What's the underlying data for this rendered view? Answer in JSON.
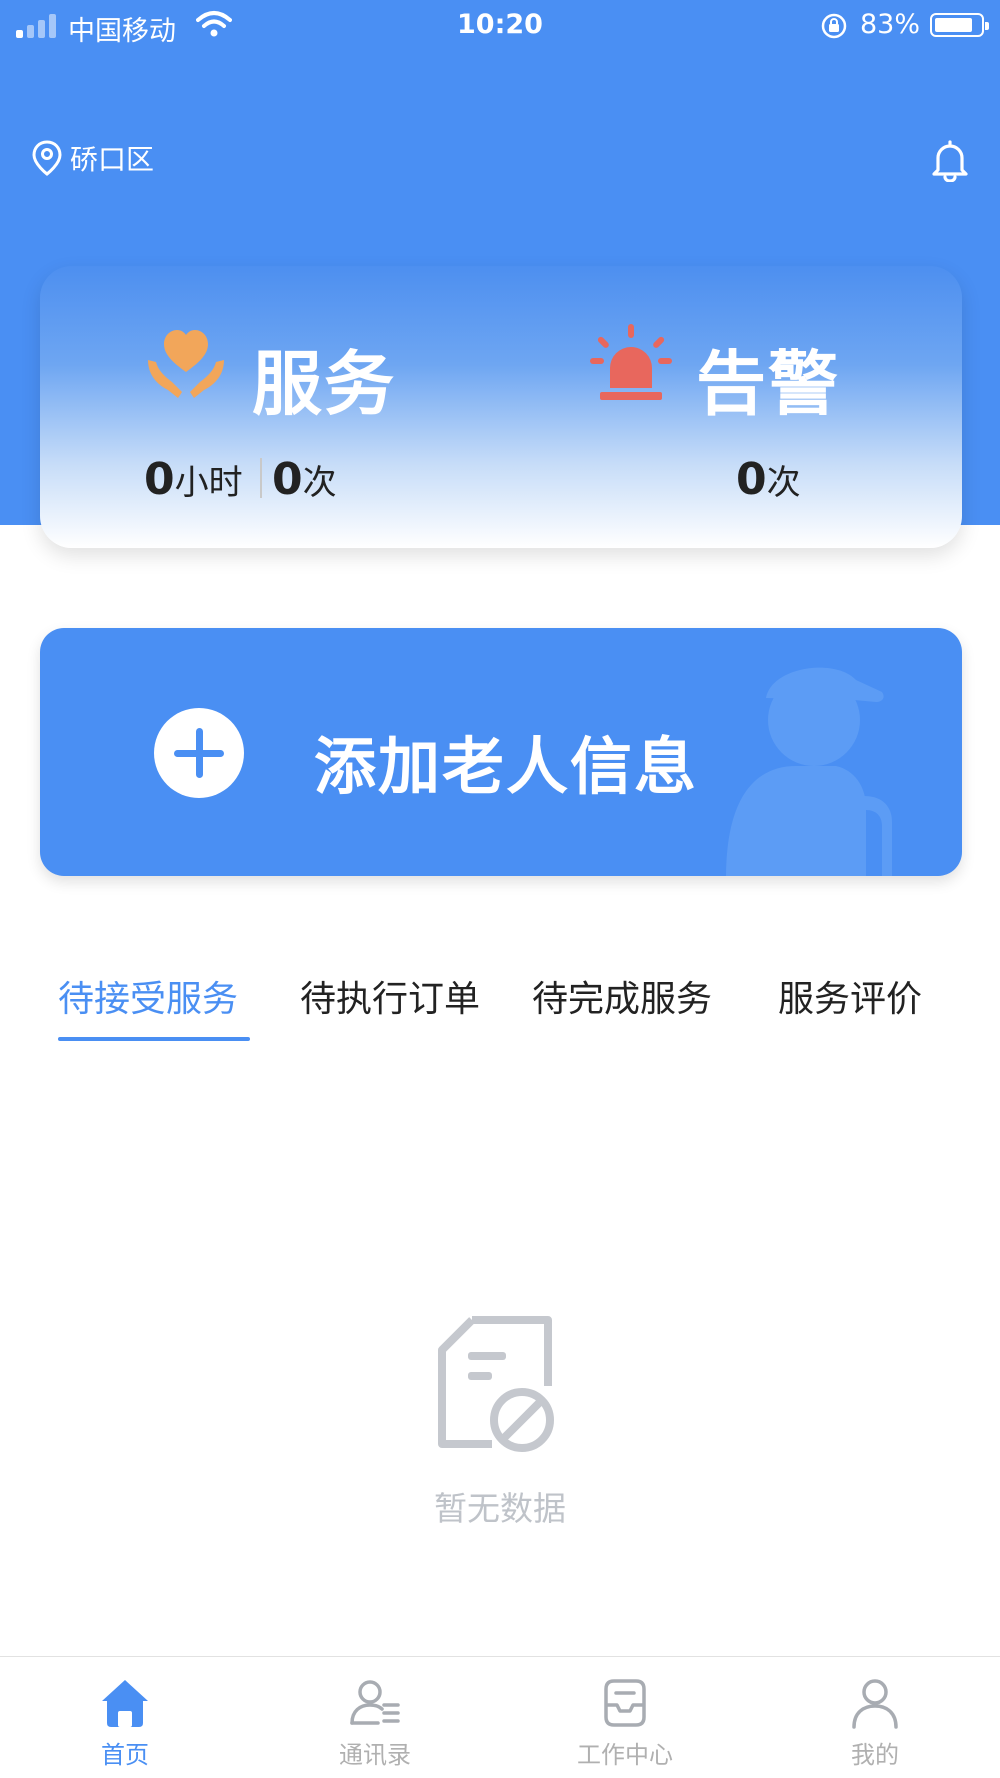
{
  "status_bar": {
    "carrier": "中国移动",
    "time": "10:20",
    "battery": "83%"
  },
  "location": {
    "district": "硚口区"
  },
  "stats": {
    "service": {
      "title": "服务",
      "hours_value": "0",
      "hours_unit": "小时",
      "count_value": "0",
      "count_unit": "次"
    },
    "alarm": {
      "title": "告警",
      "count_value": "0",
      "count_unit": "次"
    }
  },
  "add_elder": {
    "label": "添加老人信息"
  },
  "tabs": [
    {
      "label": "待接受服务",
      "active": true
    },
    {
      "label": "待执行订单",
      "active": false
    },
    {
      "label": "待完成服务",
      "active": false
    },
    {
      "label": "服务评价",
      "active": false
    }
  ],
  "empty_state": {
    "text": "暂无数据"
  },
  "bottom_nav": [
    {
      "label": "首页",
      "icon": "home-icon",
      "active": true
    },
    {
      "label": "通讯录",
      "icon": "contacts-icon",
      "active": false
    },
    {
      "label": "工作中心",
      "icon": "inbox-icon",
      "active": false
    },
    {
      "label": "我的",
      "icon": "user-icon",
      "active": false
    }
  ],
  "colors": {
    "primary": "#4a8ff3",
    "service_icon": "#f2a65a",
    "alarm_icon": "#e8675d",
    "muted": "#bfc3c9"
  }
}
